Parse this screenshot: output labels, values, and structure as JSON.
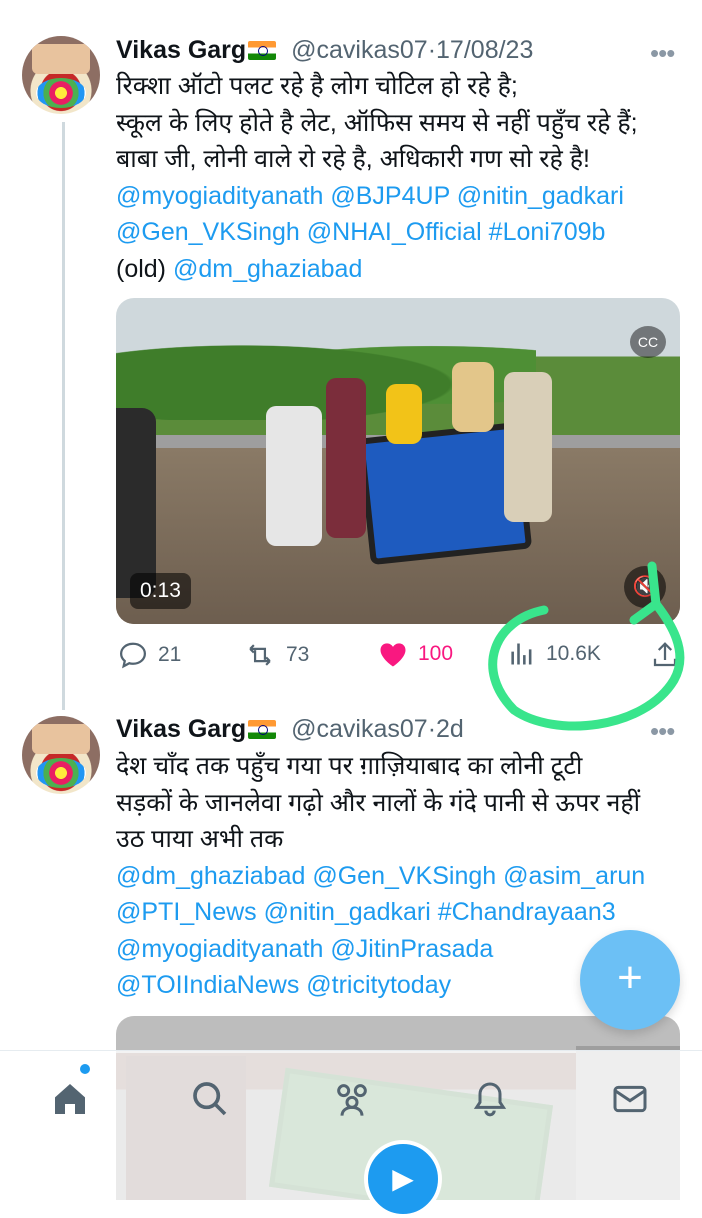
{
  "tweets": [
    {
      "author": "Vikas Garg",
      "handle": "@cavikas07",
      "sep": "·",
      "date": "17/08/23",
      "more": "•••",
      "lines": [
        "रिक्शा ऑटो पलट रहे है लोग चोटिल हो रहे है;",
        "स्कूल के लिए होते है लेट, ऑफिस समय से नहीं पहुँच रहे हैं;",
        "बाबा जी, लोनी वाले रो रहे है, अधिकारी गण सो रहे है!"
      ],
      "mentions_line1": "@myogiadityanath @BJP4UP @nitin_gadkari",
      "mentions_line2": "@Gen_VKSingh @NHAI_Official #Loni709b",
      "old_prefix": "(old) ",
      "mentions_line3": "@dm_ghaziabad",
      "video_time": "0:13",
      "replies": "21",
      "retweets": "73",
      "likes": "100",
      "views": "10.6K"
    },
    {
      "author": "Vikas Garg",
      "handle": "@cavikas07",
      "sep": "·",
      "date": "2d",
      "more": "•••",
      "lines": [
        "देश चाँद तक पहुँच गया पर ग़ाज़ियाबाद का लोनी टूटी",
        "सड़कों के जानलेवा गढ़ो और नालों के गंदे पानी से ऊपर नहीं",
        "उठ पाया अभी तक"
      ],
      "mentions": [
        "@dm_ghaziabad @Gen_VKSingh @asim_arun",
        "@PTI_News @nitin_gadkari #Chandrayaan3",
        "@myogiadityanath @JitinPrasada",
        "@TOIIndiaNews @tricitytoday"
      ]
    }
  ],
  "fab_label": "+",
  "colors": {
    "link": "#1d9bf0",
    "like": "#f91880",
    "annotation": "#39e58c",
    "fab": "#6cc0f5"
  },
  "icons": [
    "reply-icon",
    "retweet-icon",
    "heart-icon",
    "views-icon",
    "share-icon",
    "home-icon",
    "search-icon",
    "communities-icon",
    "notifications-icon",
    "messages-icon"
  ]
}
